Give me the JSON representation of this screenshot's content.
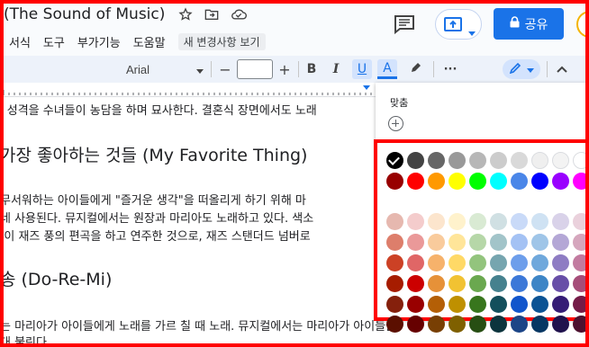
{
  "title": "(The Sound of Music)",
  "menu": [
    "서식",
    "도구",
    "부가기능",
    "도움말"
  ],
  "last_edit": "새 변경사항 보기",
  "share_label": "공유",
  "toolbar": {
    "font": "Arial",
    "minus": "−",
    "plus": "+",
    "bold": "B",
    "italic": "I",
    "underline": "U",
    "text_color": "A",
    "more": "···"
  },
  "doc": {
    "line1": "l 성격을 수녀들이 농담을 하며 묘사한다. 결혼식 장면에서도 노래",
    "heading1": "가장 좋아하는 것들 (My Favorite Thing)",
    "line2": "무서워하는 아이들에게 \"즐거운 생각\"을 떠올리게 하기 위해 마",
    "line3": "네 사용된다. 뮤지컬에서는 원장과 마리아도 노래하고 있다. 색소",
    "line4": "|이 재즈 풍의 편곡을 하고 연주한 것으로, 재즈 스탠더드 넘버로",
    "heading2": "송 (Do-Re-Mi)",
    "line5": "는 마리아가 아이들에게 노래를 가르 칠 때 노래. 뮤지컬에서는 마리아가 아이들을",
    "line6": "대 불린다"
  },
  "popup": {
    "custom_label": "맞춤",
    "palette": [
      [
        "#000000",
        "#434343",
        "#666666",
        "#999999",
        "#b7b7b7",
        "#cccccc",
        "#d9d9d9",
        "#efefef",
        "#f3f3f3",
        "#ffffff"
      ],
      [
        "#980000",
        "#ff0000",
        "#ff9900",
        "#ffff00",
        "#00ff00",
        "#00ffff",
        "#4a86e8",
        "#0000ff",
        "#9900ff",
        "#ff00ff"
      ],
      [
        "#e6b8af",
        "#f4cccc",
        "#fce5cd",
        "#fff2cc",
        "#d9ead3",
        "#d0e0e3",
        "#c9daf8",
        "#cfe2f3",
        "#d9d2e9",
        "#ead1dc"
      ],
      [
        "#dd7e6b",
        "#ea9999",
        "#f9cb9c",
        "#ffe599",
        "#b6d7a8",
        "#a2c4c9",
        "#a4c2f4",
        "#9fc5e8",
        "#b4a7d6",
        "#d5a6bd"
      ],
      [
        "#cc4125",
        "#e06666",
        "#f6b26b",
        "#ffd966",
        "#93c47d",
        "#76a5af",
        "#6d9eeb",
        "#6fa8dc",
        "#8e7cc3",
        "#c27ba0"
      ],
      [
        "#a61c00",
        "#cc0000",
        "#e69138",
        "#f1c232",
        "#6aa84f",
        "#45818e",
        "#3c78d8",
        "#3d85c6",
        "#674ea7",
        "#a64d79"
      ],
      [
        "#85200c",
        "#990000",
        "#b45f06",
        "#bf9000",
        "#38761d",
        "#134f5c",
        "#1155cc",
        "#0b5394",
        "#351c75",
        "#741b47"
      ],
      [
        "#5b0f00",
        "#660000",
        "#783f04",
        "#7f6000",
        "#274e13",
        "#0c343d",
        "#1c4587",
        "#073763",
        "#20124d",
        "#4c1130"
      ]
    ],
    "selected_color": "#000000"
  }
}
